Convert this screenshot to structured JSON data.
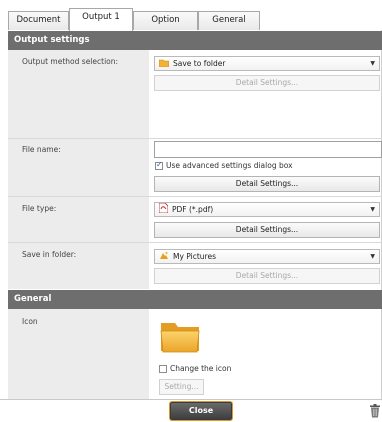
{
  "tabs": [
    {
      "label": "Document"
    },
    {
      "label": "Output 1"
    },
    {
      "label": "Option"
    },
    {
      "label": "General"
    }
  ],
  "output_settings": {
    "header": "Output settings",
    "method": {
      "label": "Output method selection:",
      "value": "Save to folder",
      "detail_button": "Detail Settings..."
    },
    "file_name": {
      "label": "File name:",
      "value": "",
      "advanced_checkbox": "Use advanced settings dialog box",
      "advanced_checked": true,
      "detail_button": "Detail Settings..."
    },
    "file_type": {
      "label": "File type:",
      "value": "PDF (*.pdf)",
      "detail_button": "Detail Settings..."
    },
    "save_in_folder": {
      "label": "Save in folder:",
      "value": "My Pictures",
      "detail_button": "Detail Settings..."
    }
  },
  "general": {
    "header": "General",
    "icon_label": "Icon",
    "change_icon_checkbox": "Change the icon",
    "change_icon_checked": false,
    "setting_button": "Setting..."
  },
  "footer": {
    "close_button": "Close"
  },
  "icons": {
    "folder": "folder-icon",
    "pdf": "pdf-icon",
    "my_pictures": "my-pictures-icon",
    "trash": "trash-icon"
  },
  "colors": {
    "section_header_bg": "#6e6e6e",
    "label_column_bg": "#ececec",
    "close_button_bg": "#4a4a4a",
    "close_button_border": "#d99a2b"
  }
}
